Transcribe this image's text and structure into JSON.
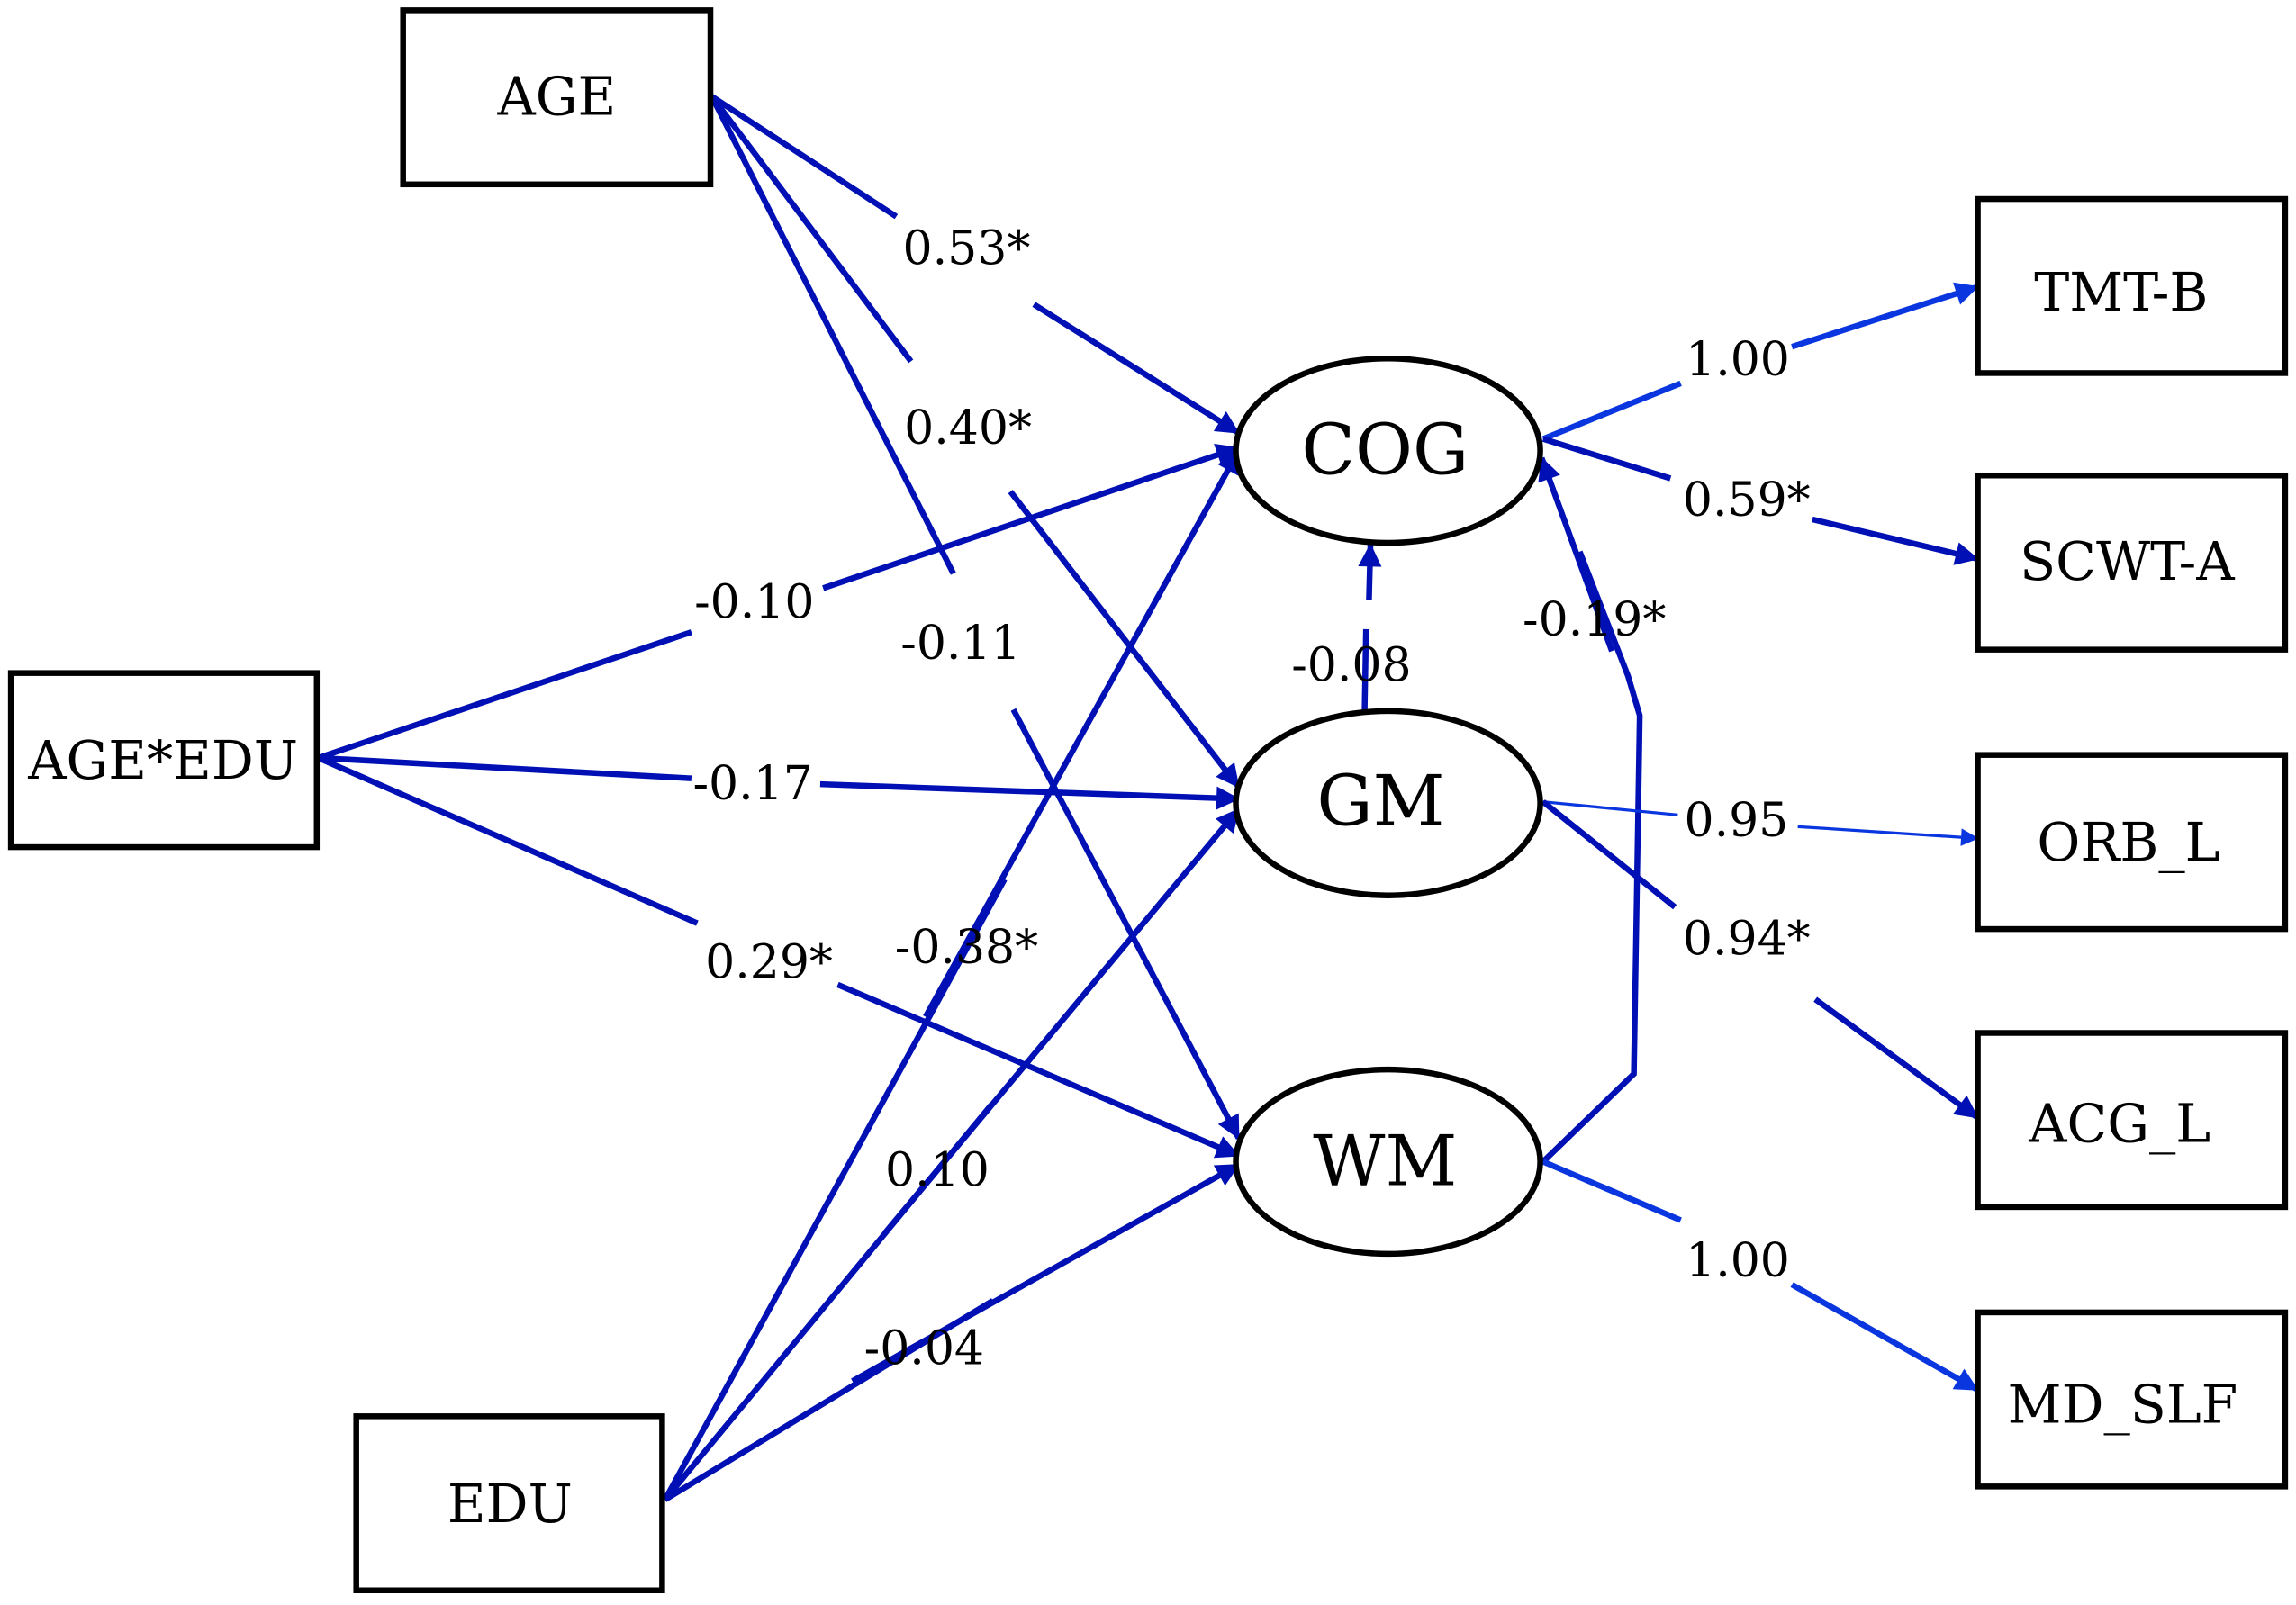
{
  "diagram": {
    "type": "structural-equation-model",
    "colors": {
      "path": "#0010b4",
      "loading": "#0a36e0",
      "node_stroke": "#000000"
    },
    "observed_predictors": [
      {
        "id": "age",
        "label": "AGE"
      },
      {
        "id": "ageedu",
        "label": "AGE*EDU"
      },
      {
        "id": "edu",
        "label": "EDU"
      }
    ],
    "latent": [
      {
        "id": "cog",
        "label": "COG"
      },
      {
        "id": "gm",
        "label": "GM"
      },
      {
        "id": "wm",
        "label": "WM"
      }
    ],
    "indicators": [
      {
        "id": "tmtb",
        "label": "TMT-B"
      },
      {
        "id": "scwta",
        "label": "SCWT-A"
      },
      {
        "id": "orbl",
        "label": "ORB_L"
      },
      {
        "id": "acgl",
        "label": "ACG_L"
      },
      {
        "id": "mdslf",
        "label": "MD_SLF"
      }
    ],
    "paths": [
      {
        "from": "age",
        "to": "cog",
        "coef": "0.53*"
      },
      {
        "from": "age",
        "to": "gm",
        "coef": "0.40*"
      },
      {
        "from": "age",
        "to": "wm",
        "coef": "-0.11"
      },
      {
        "from": "ageedu",
        "to": "cog",
        "coef": "-0.10"
      },
      {
        "from": "ageedu",
        "to": "gm",
        "coef": "-0.17"
      },
      {
        "from": "ageedu",
        "to": "wm",
        "coef": "0.29*"
      },
      {
        "from": "edu",
        "to": "cog",
        "coef": "-0.38*"
      },
      {
        "from": "edu",
        "to": "gm",
        "coef": "0.10"
      },
      {
        "from": "edu",
        "to": "wm",
        "coef": "-0.04"
      },
      {
        "from": "gm",
        "to": "cog",
        "coef": "-0.08"
      },
      {
        "from": "wm",
        "to": "cog",
        "coef": "-0.19*"
      }
    ],
    "loadings": [
      {
        "from": "cog",
        "to": "tmtb",
        "coef": "1.00"
      },
      {
        "from": "cog",
        "to": "scwta",
        "coef": "0.59*"
      },
      {
        "from": "gm",
        "to": "orbl",
        "coef": "0.95"
      },
      {
        "from": "gm",
        "to": "acgl",
        "coef": "0.94*"
      },
      {
        "from": "wm",
        "to": "mdslf",
        "coef": "1.00"
      }
    ]
  }
}
